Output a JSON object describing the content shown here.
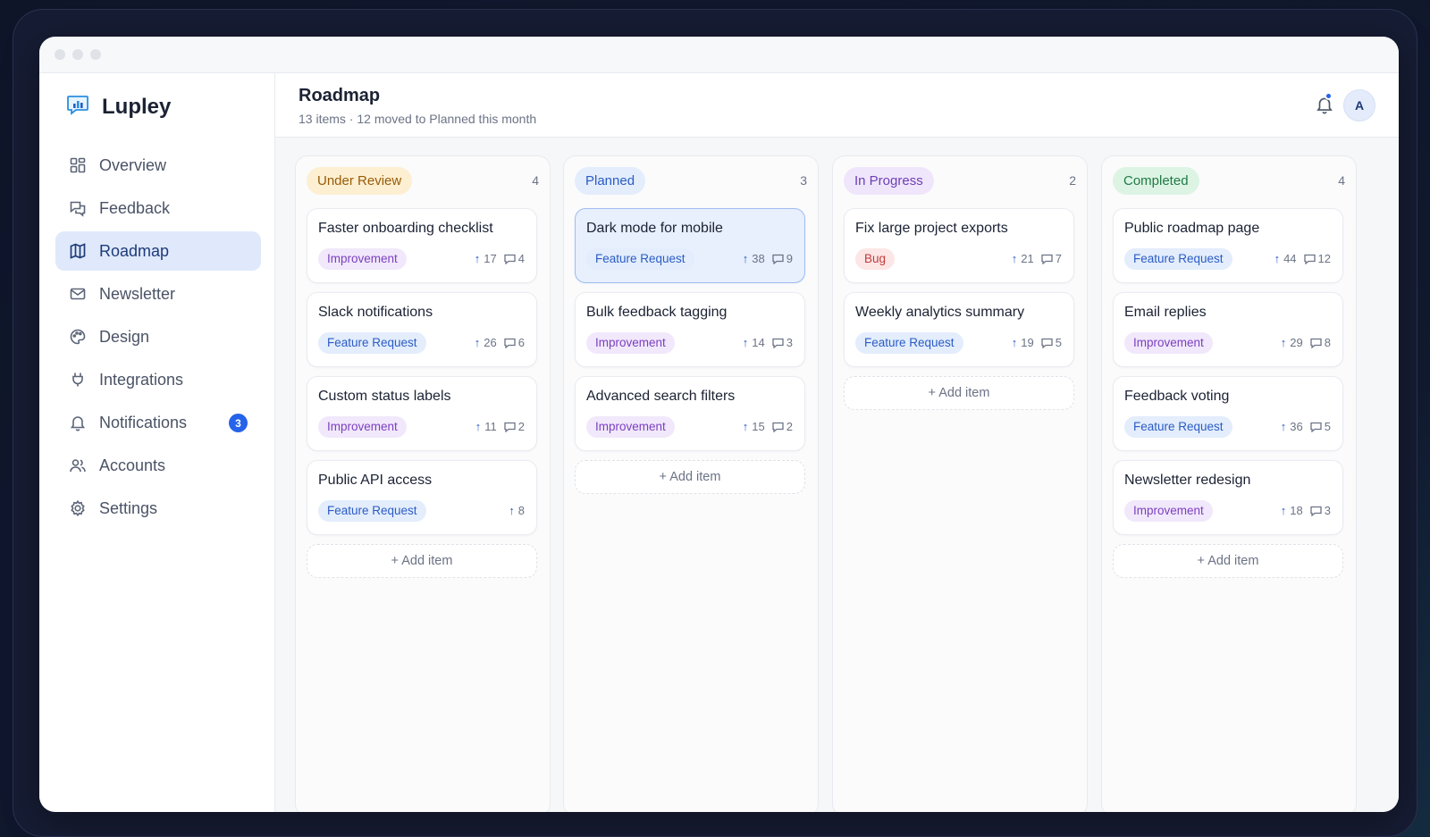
{
  "brand": {
    "name": "Lupley"
  },
  "sidebar": {
    "items": [
      {
        "label": "Overview",
        "icon": "grid-icon"
      },
      {
        "label": "Feedback",
        "icon": "chat-icon"
      },
      {
        "label": "Roadmap",
        "icon": "map-icon",
        "active": true
      },
      {
        "label": "Newsletter",
        "icon": "mail-icon"
      },
      {
        "label": "Design",
        "icon": "palette-icon"
      },
      {
        "label": "Integrations",
        "icon": "plug-icon"
      },
      {
        "label": "Notifications",
        "icon": "bell-icon",
        "badge": "3"
      },
      {
        "label": "Accounts",
        "icon": "users-icon"
      },
      {
        "label": "Settings",
        "icon": "gear-icon"
      }
    ]
  },
  "header": {
    "title": "Roadmap",
    "subtitle": "13 items · 12 moved to Planned this month",
    "avatar_initial": "A"
  },
  "board": {
    "add_label": "+ Add item",
    "columns": [
      {
        "status": "Under Review",
        "count": "4",
        "cards": [
          {
            "title": "Faster onboarding checklist",
            "tag": "Improvement",
            "votes": "17",
            "comments": "4"
          },
          {
            "title": "Slack notifications",
            "tag": "Feature Request",
            "votes": "26",
            "comments": "6"
          },
          {
            "title": "Custom status labels",
            "tag": "Improvement",
            "votes": "11",
            "comments": "2"
          },
          {
            "title": "Public API access",
            "tag": "Feature Request",
            "votes": "8"
          }
        ]
      },
      {
        "status": "Planned",
        "count": "3",
        "cards": [
          {
            "title": "Dark mode for mobile",
            "tag": "Feature Request",
            "votes": "38",
            "comments": "9",
            "selected": true
          },
          {
            "title": "Bulk feedback tagging",
            "tag": "Improvement",
            "votes": "14",
            "comments": "3"
          },
          {
            "title": "Advanced search filters",
            "tag": "Improvement",
            "votes": "15",
            "comments": "2"
          }
        ]
      },
      {
        "status": "In Progress",
        "count": "2",
        "cards": [
          {
            "title": "Fix large project exports",
            "tag": "Bug",
            "votes": "21",
            "comments": "7"
          },
          {
            "title": "Weekly analytics summary",
            "tag": "Feature Request",
            "votes": "19",
            "comments": "5"
          }
        ]
      },
      {
        "status": "Completed",
        "count": "4",
        "cards": [
          {
            "title": "Public roadmap page",
            "tag": "Feature Request",
            "votes": "44",
            "comments": "12"
          },
          {
            "title": "Email replies",
            "tag": "Improvement",
            "votes": "29",
            "comments": "8"
          },
          {
            "title": "Feedback voting",
            "tag": "Feature Request",
            "votes": "36",
            "comments": "5"
          },
          {
            "title": "Newsletter redesign",
            "tag": "Improvement",
            "votes": "18",
            "comments": "3"
          }
        ]
      }
    ]
  },
  "colors": {
    "accent": "#2563eb",
    "under_review_bg": "#fcefd2",
    "under_review_fg": "#9a5b06",
    "planned_bg": "#e3edfc",
    "planned_fg": "#2b5cc4",
    "in_progress_bg": "#efe6fb",
    "in_progress_fg": "#6e3fb5",
    "completed_bg": "#ddf4e4",
    "completed_fg": "#1f7a45"
  }
}
